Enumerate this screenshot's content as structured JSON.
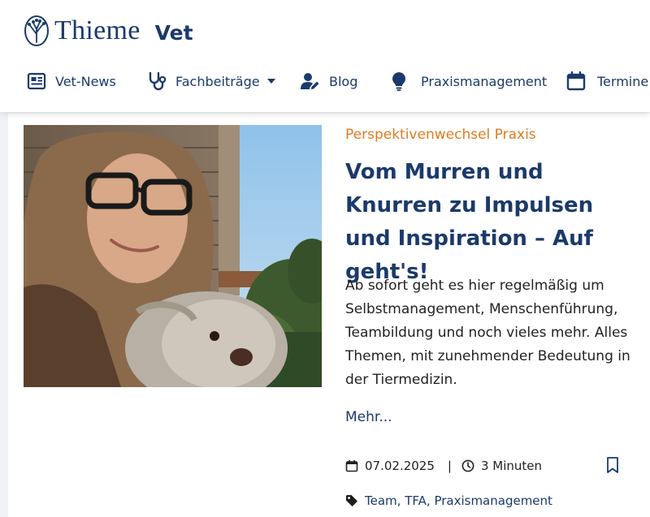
{
  "brand": {
    "name": "Thieme",
    "section": "Vet",
    "color": "#1b3a6b"
  },
  "nav": {
    "items": [
      {
        "label": "Vet-News",
        "icon": "newspaper-icon"
      },
      {
        "label": "Fachbeiträge",
        "icon": "stethoscope-icon",
        "dropdown": true
      },
      {
        "label": "Blog",
        "icon": "user-pen-icon"
      },
      {
        "label": "Praxismanagement",
        "icon": "lightbulb-icon"
      },
      {
        "label": "Termine",
        "icon": "calendar-icon"
      }
    ]
  },
  "article": {
    "category": "Perspektivenwechsel Praxis",
    "title": "Vom Murren und Knurren zu Impulsen und Inspiration – Auf geht's!",
    "teaser": "Ab sofort geht es hier regelmäßig um Selbstmanagement, Menschenführung, Teambildung und noch vieles mehr. Alles Themen, mit zunehmender Bedeutung in der Tiermedizin.",
    "more_label": "Mehr...",
    "date": "07.02.2025",
    "separator": "|",
    "reading_time": "3 Minuten",
    "tags": [
      "Team",
      "TFA",
      "Praxismanagement"
    ],
    "tag_separator": ", ",
    "image_icon": "article-photo"
  },
  "colors": {
    "accent": "#e07b1f",
    "primary": "#1b3a6b",
    "page_bg": "#f0f2f5"
  }
}
